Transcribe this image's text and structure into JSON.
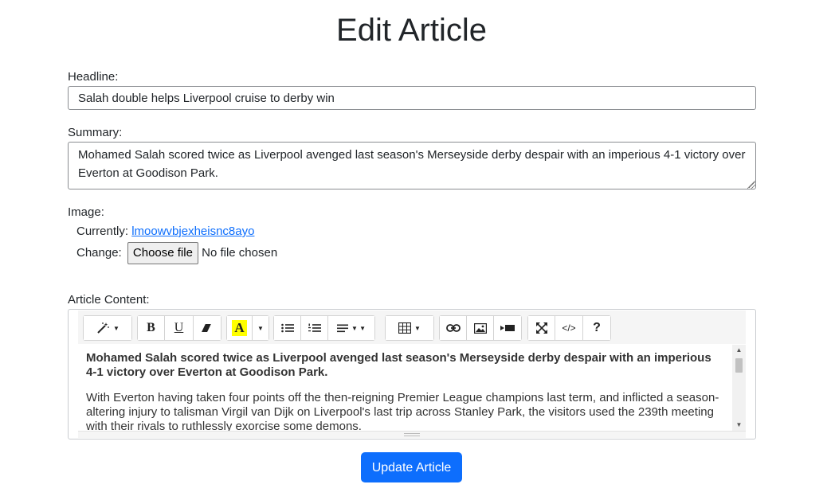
{
  "page": {
    "title": "Edit Article"
  },
  "form": {
    "headline_label": "Headline:",
    "headline_value": "Salah double helps Liverpool cruise to derby win",
    "summary_label": "Summary:",
    "summary_value": "Mohamed Salah scored twice as Liverpool avenged last season's Merseyside derby despair with an imperious 4-1 victory over Everton at Goodison Park.",
    "image_label": "Image:",
    "currently_label": "Currently:",
    "currently_link": "lmoowvbjexheisnc8ayo",
    "change_label": "Change:",
    "choose_file_label": "Choose file",
    "no_file_text": "No file chosen",
    "content_label": "Article Content:",
    "submit_label": "Update Article"
  },
  "editor": {
    "toolbar_icons": [
      "magic-wand-icon",
      "bold-icon",
      "underline-icon",
      "eraser-icon",
      "text-color-icon",
      "unordered-list-icon",
      "ordered-list-icon",
      "align-icon",
      "table-icon",
      "link-icon",
      "picture-icon",
      "video-icon",
      "fullscreen-icon",
      "code-view-icon",
      "help-icon"
    ],
    "bold_glyph": "B",
    "underline_glyph": "U",
    "color_glyph": "A",
    "code_glyph": "</>",
    "help_glyph": "?",
    "paragraphs": [
      "Mohamed Salah scored twice as Liverpool avenged last season's Merseyside derby despair with an imperious 4-1 victory over Everton at Goodison Park.",
      "With Everton having taken four points off the then-reigning Premier League champions last term, and inflicted a season-altering injury to talisman Virgil van Dijk on Liverpool's last trip across Stanley Park, the visitors used the 239th meeting with their rivals to ruthlessly exorcise some demons."
    ]
  },
  "colors": {
    "primary": "#0d6efd",
    "highlight_yellow": "#ffff00"
  }
}
